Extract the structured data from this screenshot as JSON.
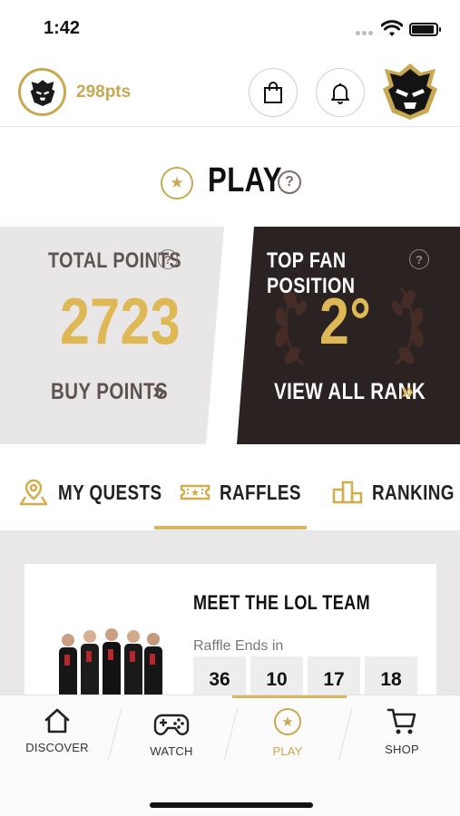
{
  "status_bar": {
    "time": "1:42"
  },
  "header": {
    "points": "298pts",
    "bag_icon": "shopping-bag-icon",
    "bell_icon": "bell-icon",
    "logo_icon": "g2-samurai-logo"
  },
  "play": {
    "title": "PLAY",
    "help": "?"
  },
  "stats": {
    "total_points": {
      "title": "TOTAL POINTS",
      "value": "2723",
      "link": "BUY POINTS",
      "link_arrow": "»"
    },
    "top_fan": {
      "title": "TOP FAN POSITION",
      "value": "2°",
      "link": "VIEW ALL RANK",
      "link_arrow": "»"
    }
  },
  "tabs": [
    {
      "label": "MY QUESTS",
      "icon": "map-pin-icon",
      "active": false
    },
    {
      "label": "RAFFLES",
      "icon": "ticket-icon",
      "active": true
    },
    {
      "label": "RANKING",
      "icon": "podium-icon",
      "active": false
    }
  ],
  "raffle": {
    "title": "MEET THE LOL TEAM",
    "subtitle": "Raffle Ends in",
    "countdown": [
      "36",
      "10",
      "17",
      "18"
    ]
  },
  "bottom_nav": [
    {
      "label": "DISCOVER",
      "icon": "home-icon",
      "active": false
    },
    {
      "label": "WATCH",
      "icon": "gamepad-icon",
      "active": false
    },
    {
      "label": "PLAY",
      "icon": "star-icon",
      "active": true
    },
    {
      "label": "SHOP",
      "icon": "cart-icon",
      "active": false
    }
  ],
  "colors": {
    "accent": "#c9a852",
    "gold_value": "#dfb856",
    "dark_panel": "#2a2321",
    "light_panel": "#e8e6e6"
  }
}
